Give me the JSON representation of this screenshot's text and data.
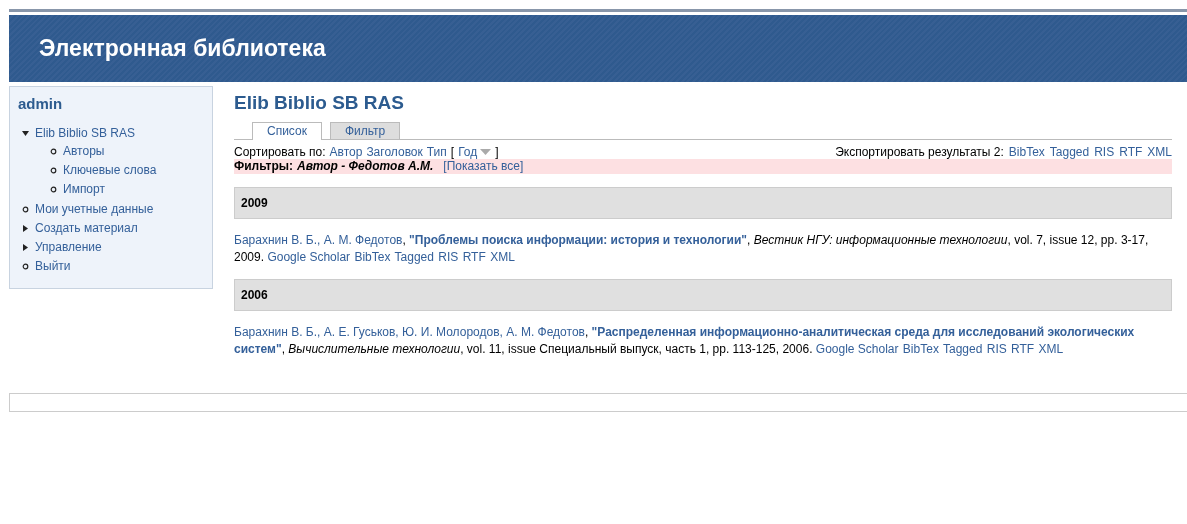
{
  "header": {
    "title": "Электронная библиотека"
  },
  "sidebar": {
    "user": "admin",
    "items": [
      {
        "label": "Elib Biblio SB RAS",
        "kind": "branch",
        "expanded": true,
        "children": [
          {
            "label": "Авторы",
            "kind": "leaf"
          },
          {
            "label": "Ключевые слова",
            "kind": "leaf"
          },
          {
            "label": "Импорт",
            "kind": "leaf"
          }
        ]
      },
      {
        "label": "Мои учетные данные",
        "kind": "leaf"
      },
      {
        "label": "Создать материал",
        "kind": "branch",
        "expanded": false
      },
      {
        "label": "Управление",
        "kind": "branch",
        "expanded": false
      },
      {
        "label": "Выйти",
        "kind": "leaf"
      }
    ]
  },
  "main": {
    "title": "Elib Biblio SB RAS",
    "tabs": [
      {
        "label": "Список",
        "selected": true
      },
      {
        "label": "Фильтр",
        "selected": false
      }
    ],
    "sort": {
      "label": "Сортировать по:",
      "options": [
        {
          "label": "Автор",
          "selected": false,
          "bracketed": false
        },
        {
          "label": "Заголовок",
          "selected": false,
          "bracketed": false
        },
        {
          "label": "Тип",
          "selected": false,
          "bracketed": false
        },
        {
          "label": "Год",
          "selected": true,
          "bracketed": true
        }
      ],
      "open_bracket": "[",
      "close_bracket": "]"
    },
    "export": {
      "label": "Экспортировать результаты 2:",
      "links": [
        "BibTex",
        "Tagged",
        "RIS",
        "RTF",
        "XML"
      ]
    },
    "filter": {
      "label": "Фильтры:",
      "value": "Автор - Федотов А.М.",
      "link": "[Показать все]"
    },
    "groups": [
      {
        "year": "2009",
        "entries": [
          {
            "authors": "Барахнин В. Б., А. М. Федотов",
            "sep": ", ",
            "sep2": ", ",
            "title": "\"Проблемы поиска информации: история и технологии\"",
            "journal": "Вестник НГУ: информационные технологии",
            "details": ", vol. 7, issue 12, pp. 3-17, 2009.",
            "links": [
              "Google Scholar",
              "BibTex",
              "Tagged",
              "RIS",
              "RTF",
              "XML"
            ]
          }
        ]
      },
      {
        "year": "2006",
        "entries": [
          {
            "authors": "Барахнин В. Б., А. Е. Гуськов, Ю. И. Молородов, А. М. Федотов",
            "sep": ", ",
            "sep2": ", ",
            "title": "\"Распределенная информационно-аналитическая среда для исследований экологических систем\"",
            "journal": "Вычислительные технологии",
            "details": ", vol. 11, issue Специальный выпуск, часть 1, pp. 113-125, 2006.",
            "links": [
              "Google Scholar",
              "BibTex",
              "Tagged",
              "RIS",
              "RTF",
              "XML"
            ]
          }
        ]
      }
    ]
  }
}
